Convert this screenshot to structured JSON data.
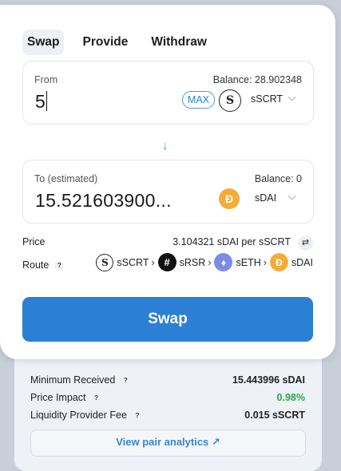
{
  "tabs": [
    "Swap",
    "Provide",
    "Withdraw"
  ],
  "from": {
    "label": "From",
    "balance": "Balance: 28.902348",
    "amount": "5",
    "max_label": "MAX",
    "token": "sSCRT"
  },
  "to": {
    "label": "To (estimated)",
    "balance": "Balance: 0",
    "amount": "15.521603900...",
    "token": "sDAI"
  },
  "price": {
    "label": "Price",
    "value": "3.104321 sDAI per sSCRT"
  },
  "route": {
    "label": "Route",
    "hops": [
      "sSCRT",
      "sRSR",
      "sETH",
      "sDAI"
    ]
  },
  "swap_button": "Swap",
  "details": {
    "min_received_label": "Minimum Received",
    "min_received_value": "15.443996 sDAI",
    "price_impact_label": "Price Impact",
    "price_impact_value": "0.98%",
    "lp_fee_label": "Liquidity Provider Fee",
    "lp_fee_value": "0.015 sSCRT",
    "analytics_link": "View pair analytics ↗"
  },
  "colors": {
    "accent": "#2b7fd4",
    "positive": "#2ea44f",
    "dai": "#f5ac37",
    "eth": "#7b8be6"
  },
  "icons": {
    "scrt": "secret-network-icon",
    "dai": "dai-icon",
    "rsr": "reserve-rights-icon",
    "eth": "ethereum-icon"
  }
}
